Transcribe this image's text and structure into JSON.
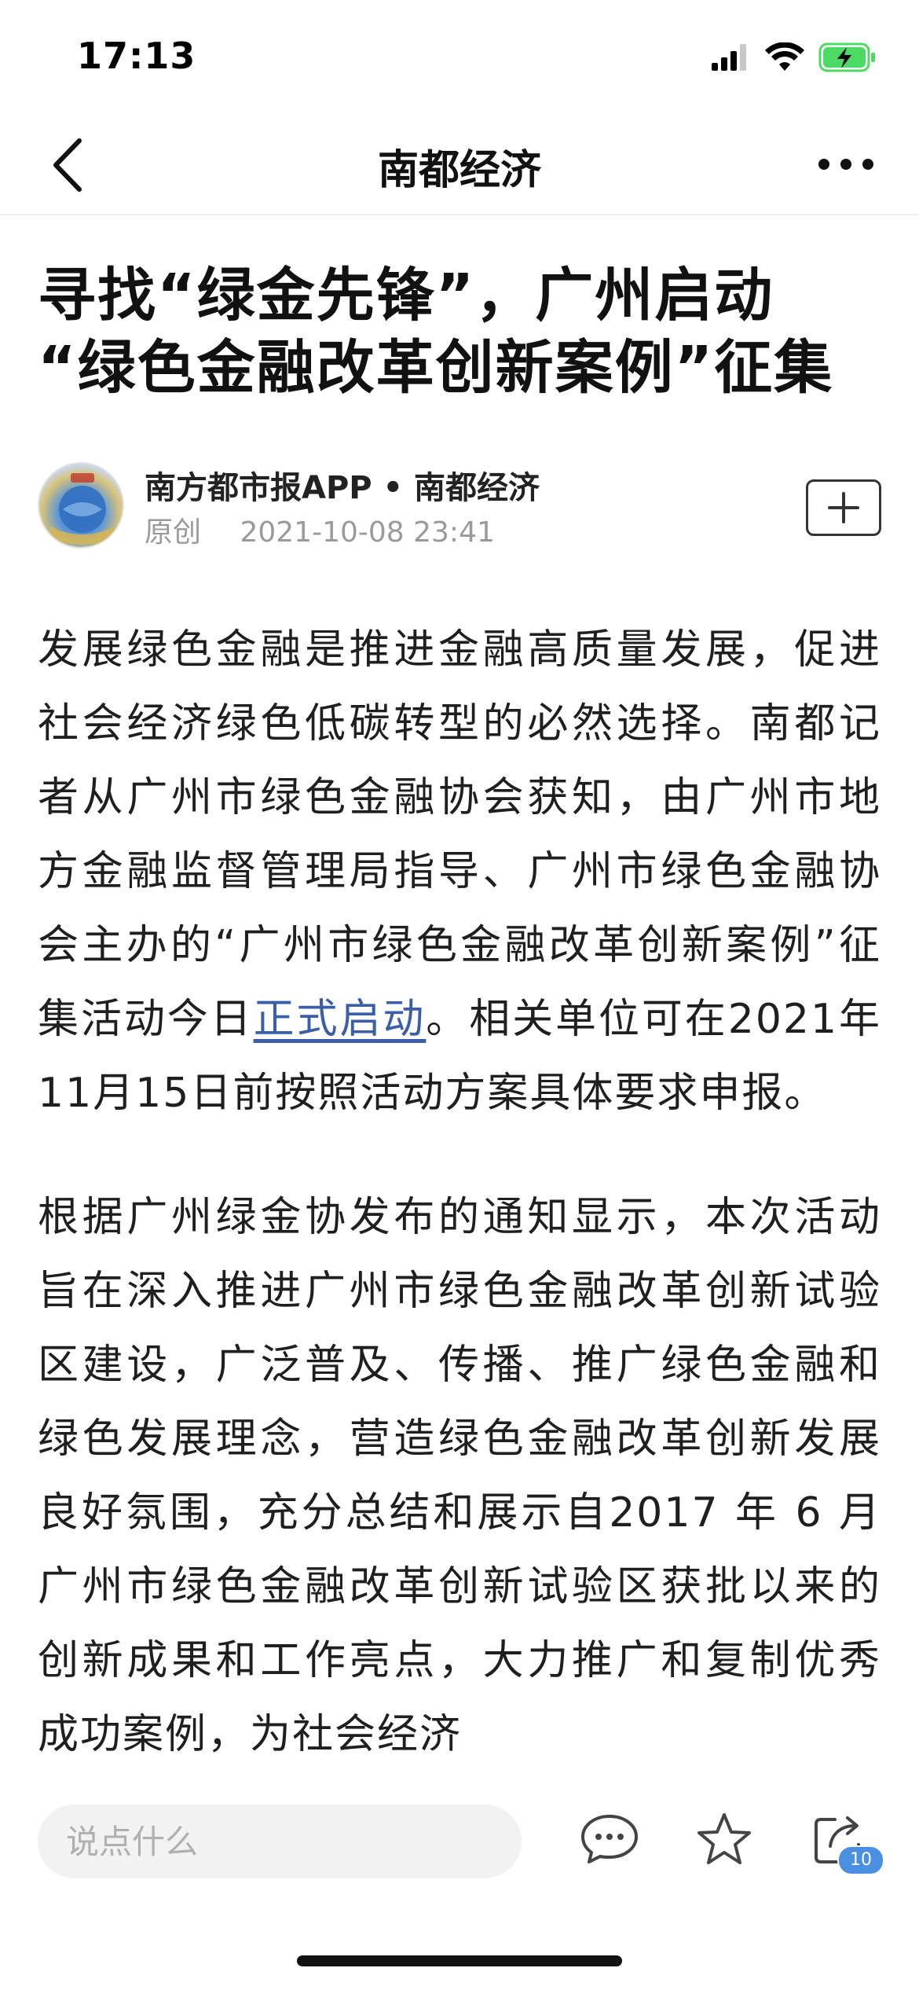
{
  "status_bar": {
    "time": "17:13"
  },
  "nav": {
    "title": "南都经济"
  },
  "article": {
    "title_line1": "寻找“绿金先锋”，广州启动",
    "title_line2": "“绿色金融改革创新案例”征集",
    "author": {
      "name": "南方都市报APP • 南都经济",
      "tag": "原创",
      "datetime": "2021-10-08 23:41"
    },
    "paragraph1_before_link": "发展绿色金融是推进金融高质量发展，促进社会经济绿色低碳转型的必然选择。南都记者从广州市绿色金融协会获知，由广州市地方金融监督管理局指导、广州市绿色金融协会主办的“广州市绿色金融改革创新案例”征集活动今日",
    "paragraph1_link": "正式启动",
    "paragraph1_after_link": "。相关单位可在2021年11月15日前按照活动方案具体要求申报。",
    "paragraph2": "根据广州绿金协发布的通知显示，本次活动旨在深入推进广州市绿色金融改革创新试验区建设，广泛普及、传播、推广绿色金融和绿色发展理念，营造绿色金融改革创新发展良好氛围，充分总结和展示自2017 年 6 月广州市绿色金融改革创新试验区获批以来的创新成果和工作亮点，大力推广和复制优秀成功案例，为社会经济"
  },
  "bottom_bar": {
    "comment_placeholder": "说点什么",
    "share_count": "10"
  },
  "colors": {
    "link": "#3b5ea8",
    "battery_green": "#4cd964",
    "badge_blue": "#4a90e2"
  }
}
